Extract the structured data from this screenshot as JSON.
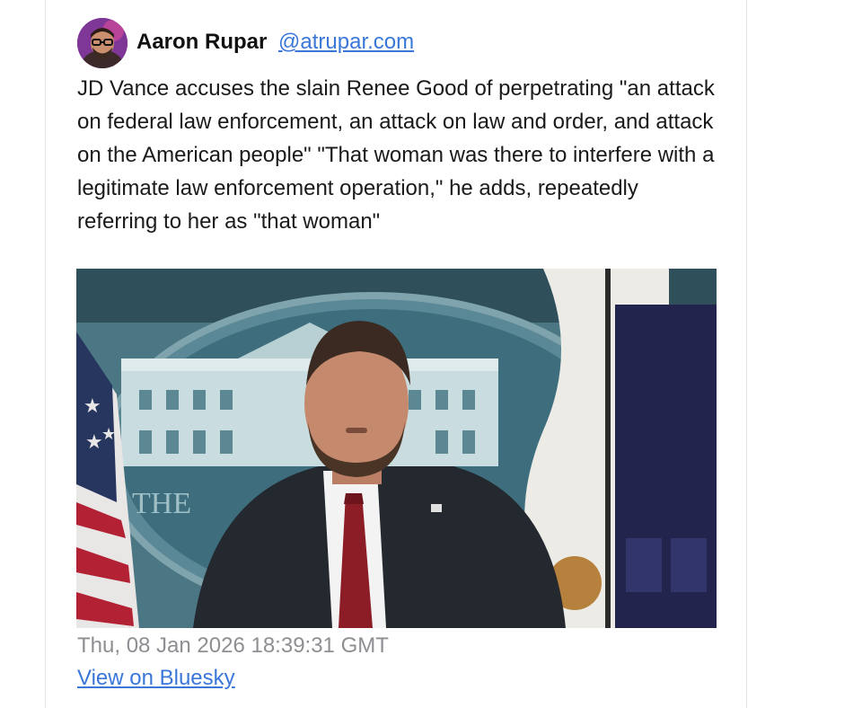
{
  "post": {
    "author_name": "Aaron Rupar",
    "author_handle": "@atrupar.com",
    "text": "JD Vance accuses the slain Renee Good of perpetrating \"an attack on federal law enforcement, an attack on law and order, and attack on the American people\" \"That woman was there to interfere with a legitimate law enforcement operation,\" he adds, repeatedly referring to her as \"that woman\"",
    "timestamp": "Thu, 08 Jan 2026 18:39:31 GMT",
    "view_link": "View on Bluesky",
    "media": {
      "backdrop_sign_text": "THE"
    }
  },
  "colors": {
    "link": "#3a77d9",
    "timestamp": "#8e8e93",
    "backdrop_blue": "#3f6a78"
  },
  "icons": {
    "avatar": "author-avatar",
    "flag_pin": "flag-lapel-pin-icon"
  }
}
